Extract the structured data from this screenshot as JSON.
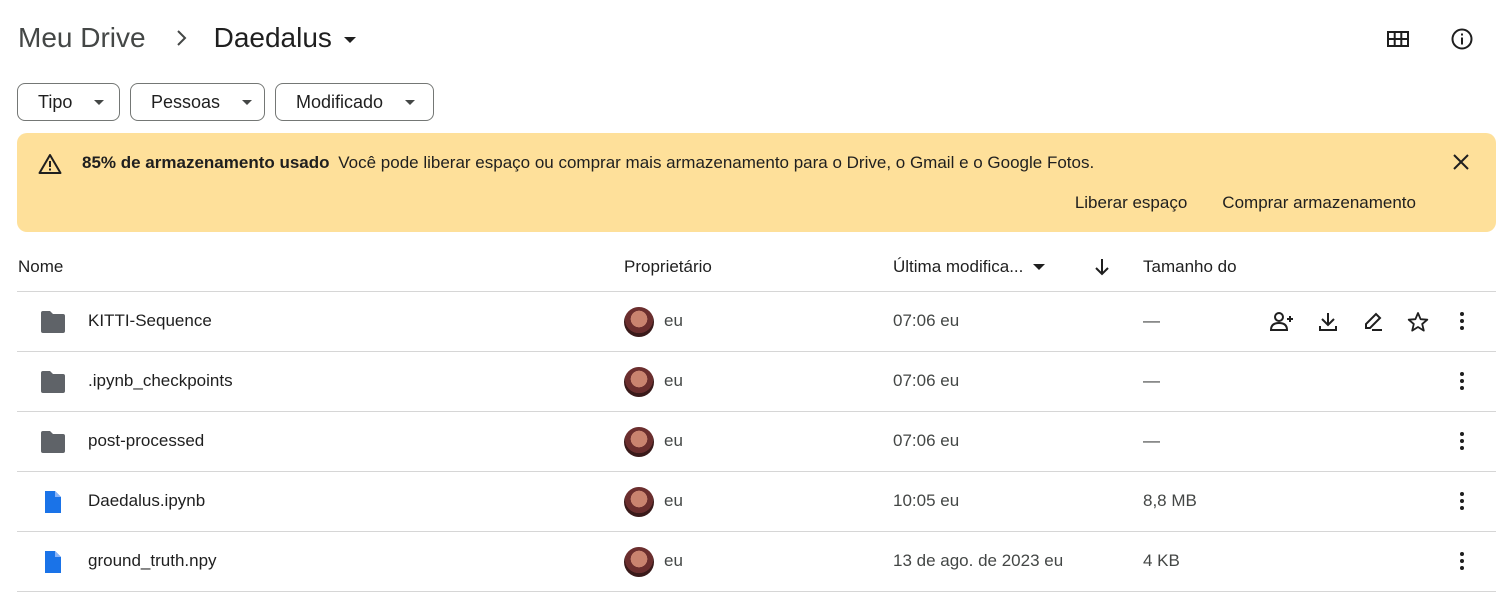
{
  "breadcrumb": {
    "root": "Meu Drive",
    "current": "Daedalus"
  },
  "filters": {
    "tipo": "Tipo",
    "pessoas": "Pessoas",
    "modificado": "Modificado"
  },
  "banner": {
    "title": "85% de armazenamento usado",
    "message": "Você pode liberar espaço ou comprar mais armazenamento para o Drive, o Gmail e o Google Fotos.",
    "free_up": "Liberar espaço",
    "buy": "Comprar armazenamento",
    "bg_color": "#fee09a"
  },
  "columns": {
    "name": "Nome",
    "owner": "Proprietário",
    "modified": "Última modifica...",
    "size": "Tamanho do"
  },
  "rows": [
    {
      "type": "folder-icon",
      "name": "KITTI-Sequence",
      "owner": "eu",
      "modified": "07:06 eu",
      "size": "—"
    },
    {
      "type": "folder-icon",
      "name": ".ipynb_checkpoints",
      "owner": "eu",
      "modified": "07:06 eu",
      "size": "—"
    },
    {
      "type": "folder-icon",
      "name": "post-processed",
      "owner": "eu",
      "modified": "07:06 eu",
      "size": "—"
    },
    {
      "type": "file-icon",
      "name": "Daedalus.ipynb",
      "owner": "eu",
      "modified": "10:05 eu",
      "size": "8,8 MB"
    },
    {
      "type": "file-icon",
      "name": "ground_truth.npy",
      "owner": "eu",
      "modified": "13 de ago. de 2023 eu",
      "size": "4 KB"
    }
  ],
  "colors": {
    "folder": "#5f6368",
    "file": "#1a73e8"
  }
}
